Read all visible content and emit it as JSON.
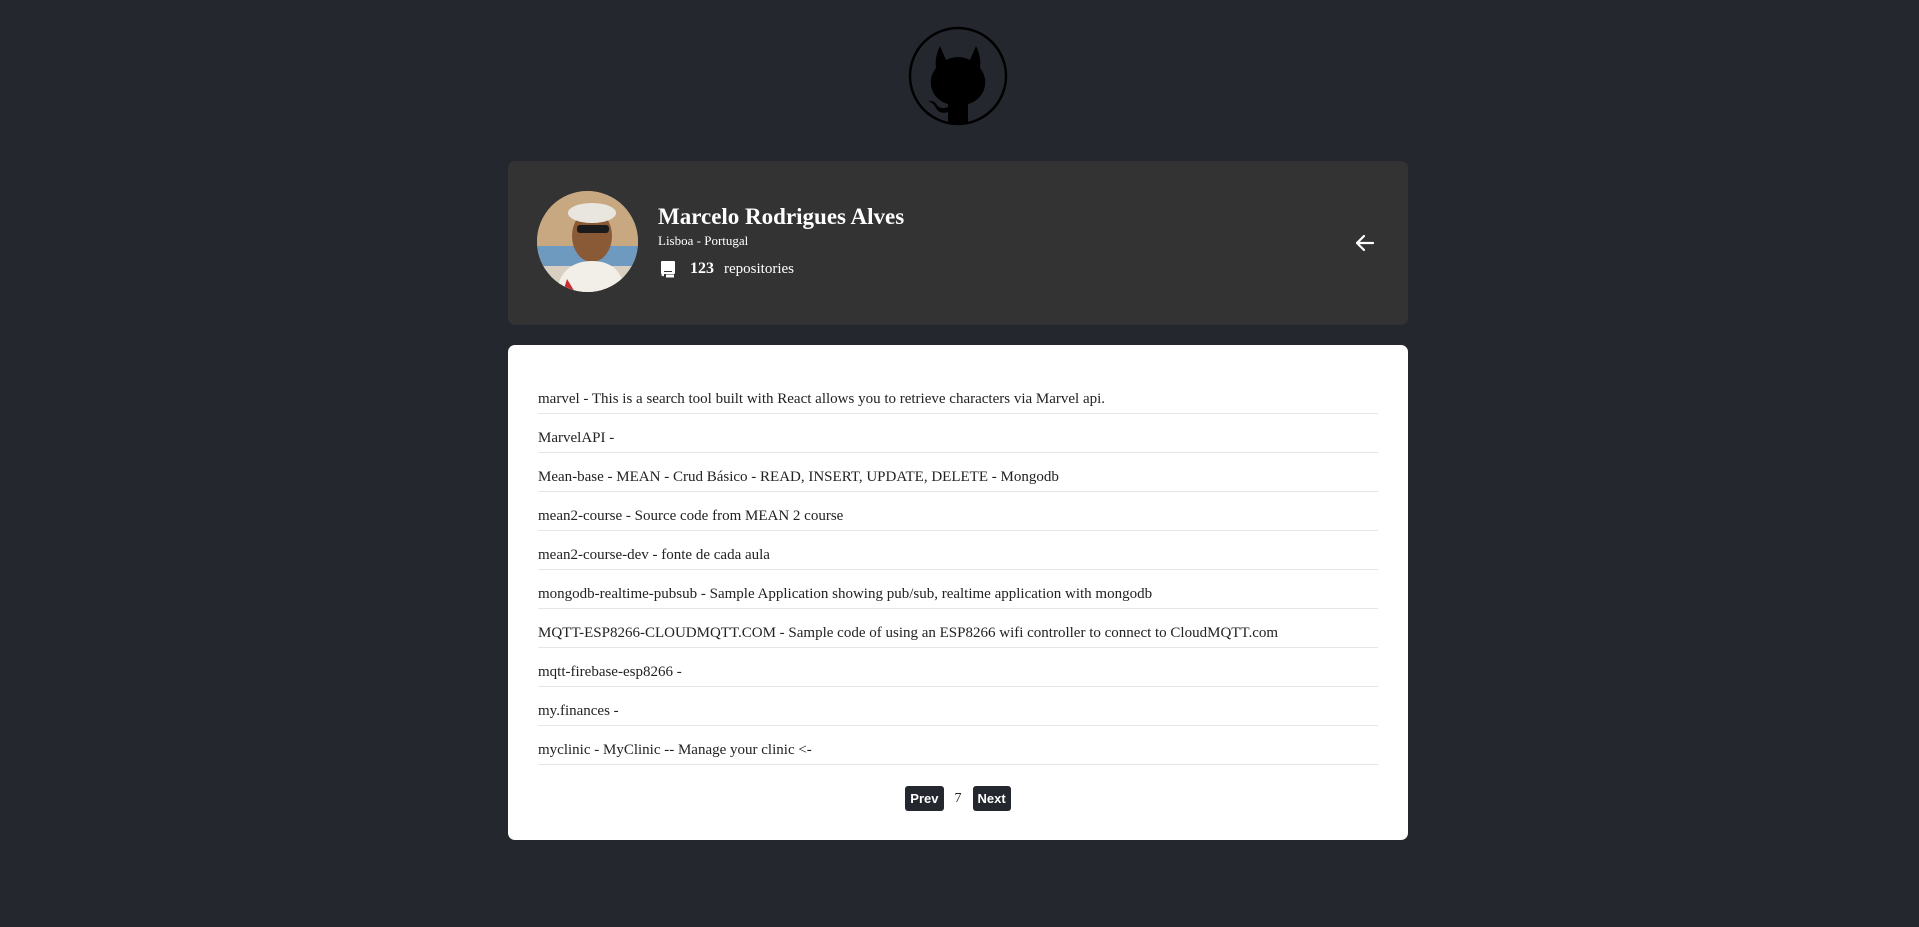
{
  "logo": {
    "icon": "github-octocat-icon"
  },
  "profile": {
    "name": "Marcelo Rodrigues Alves",
    "location": "Lisboa - Portugal",
    "repo_count": "123",
    "repo_label": "repositories",
    "avatar_icon": "user-avatar",
    "back_icon": "arrow-left-icon"
  },
  "repositories": [
    "marvel - This is a search tool built with React allows you to retrieve characters via Marvel api.",
    "MarvelAPI -",
    "Mean-base - MEAN - Crud Básico - READ, INSERT, UPDATE, DELETE - Mongodb",
    "mean2-course - Source code from MEAN 2 course",
    "mean2-course-dev - fonte de cada aula",
    "mongodb-realtime-pubsub - Sample Application showing pub/sub, realtime application with mongodb",
    "MQTT-ESP8266-CLOUDMQTT.COM - Sample code of using an ESP8266 wifi controller to connect to CloudMQTT.com",
    "mqtt-firebase-esp8266 -",
    "my.finances -",
    "myclinic - MyClinic -- Manage your clinic <-"
  ],
  "pagination": {
    "prev_label": "Prev",
    "current_page": "7",
    "next_label": "Next"
  },
  "colors": {
    "background": "#24272e",
    "card_dark": "#333333",
    "card_light": "#ffffff",
    "button": "#24272e"
  }
}
